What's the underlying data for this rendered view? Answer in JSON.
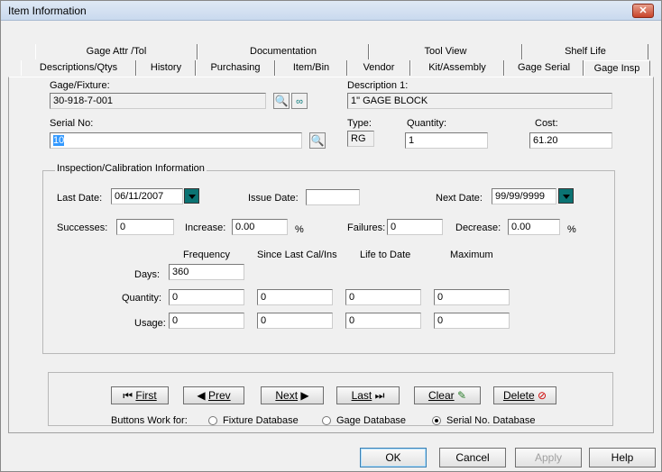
{
  "window": {
    "title": "Item Information",
    "close_glyph": "✕"
  },
  "tabs_row1": [
    "Gage Attr /Tol",
    "Documentation",
    "Tool View",
    "Shelf Life"
  ],
  "tabs_row2": [
    "Descriptions/Qtys",
    "History",
    "Purchasing",
    "Item/Bin",
    "Vendor",
    "Kit/Assembly",
    "Gage Serial",
    "Gage Insp"
  ],
  "form": {
    "gage_label": "Gage/Fixture:",
    "gage_value": "30-918-7-001",
    "desc_label": "Description 1:",
    "desc_value": "1\" GAGE BLOCK",
    "serial_label": "Serial No:",
    "serial_value": "10",
    "type_label": "Type:",
    "type_value": "RG",
    "qty_label": "Quantity:",
    "qty_value": "1",
    "cost_label": "Cost:",
    "cost_value": "61.20"
  },
  "inspection": {
    "title": "Inspection/Calibration Information",
    "last_date_label": "Last Date:",
    "last_date_value": "06/11/2007",
    "issue_date_label": "Issue Date:",
    "issue_date_value": "",
    "next_date_label": "Next Date:",
    "next_date_value": "99/99/9999",
    "successes_label": "Successes:",
    "successes_value": "0",
    "increase_label": "Increase:",
    "increase_value": "0.00",
    "increase_unit": "%",
    "failures_label": "Failures:",
    "failures_value": "0",
    "decrease_label": "Decrease:",
    "decrease_value": "0.00",
    "decrease_unit": "%",
    "col_frequency": "Frequency",
    "col_since": "Since Last Cal/Ins",
    "col_life": "Life to Date",
    "col_max": "Maximum",
    "days_label": "Days:",
    "days_frequency": "360",
    "quantity_label": "Quantity:",
    "quantity_values": [
      "0",
      "0",
      "0",
      "0"
    ],
    "usage_label": "Usage:",
    "usage_values": [
      "0",
      "0",
      "0",
      "0"
    ]
  },
  "nav": {
    "first": "First",
    "prev": "Prev",
    "next": "Next",
    "last": "Last",
    "clear": "Clear",
    "delete": "Delete",
    "buttons_work_for": "Buttons Work for:",
    "radio_fixture": "Fixture Database",
    "radio_gage": "Gage Database",
    "radio_serial": "Serial No. Database",
    "selected": "serial"
  },
  "bottom": {
    "ok": "OK",
    "cancel": "Cancel",
    "apply": "Apply",
    "help": "Help"
  }
}
